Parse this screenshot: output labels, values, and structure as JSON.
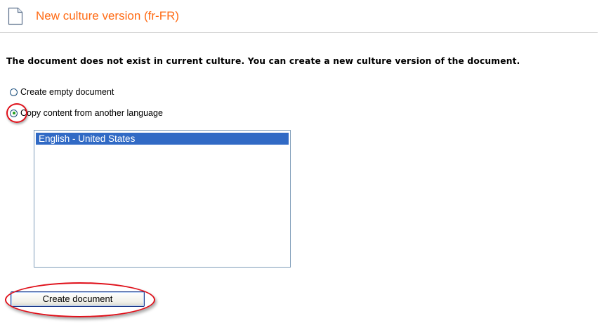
{
  "header": {
    "title": "New culture version (fr-FR)",
    "icon": "document-icon",
    "title_color": "#ff6a13"
  },
  "message": "The document does not exist in current culture. You can create a new culture version of the document.",
  "options": {
    "empty": {
      "label": "Create empty document",
      "checked": false
    },
    "copy": {
      "label": "Copy content from another language",
      "checked": true
    }
  },
  "language_list": {
    "items": [
      "English - United States"
    ],
    "selected": "English - United States"
  },
  "actions": {
    "create_label": "Create document"
  },
  "annotations": {
    "color": "#e0101a",
    "highlighted": [
      "copy-content-radio",
      "create-document-button"
    ]
  }
}
